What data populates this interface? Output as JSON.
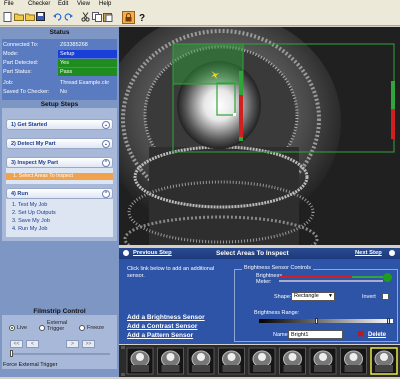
{
  "menu": [
    "File",
    "Checker",
    "Edit",
    "View",
    "Help"
  ],
  "status": {
    "title": "Status",
    "rows": [
      {
        "label": "Connected To:",
        "value": "Z63385268",
        "color": "#5a7bbf"
      },
      {
        "label": "Mode:",
        "value": "Setup",
        "color": "#1a3fd8"
      },
      {
        "label": "Part Detected:",
        "value": "Yes",
        "color": "#1e8c1e"
      },
      {
        "label": "Part Status:",
        "value": "Pass",
        "color": "#1e8c1e"
      },
      {
        "label": "Job:",
        "value": "Thread Example.ckr",
        "color": "#5a7bbf"
      },
      {
        "label": "Saved To Checker:",
        "value": "No",
        "color": "#5a7bbf"
      }
    ]
  },
  "setup": {
    "title": "Setup Steps",
    "steps": [
      "1) Get Started",
      "2) Detect My Part",
      "3) Inspect My Part",
      "4) Run"
    ],
    "active_substep": "1. Select Areas To Inspect",
    "run_links": [
      "1. Test My Job",
      "2. Set Up Outputs",
      "3. Save My Job",
      "4. Run My Job"
    ]
  },
  "filmstrip": {
    "title": "Filmstrip Control",
    "modes": [
      "Live",
      "External Trigger",
      "Freeze"
    ],
    "selected_mode": "Live",
    "nav": [
      "<<",
      "<",
      ">",
      ">>"
    ],
    "force_trigger": "Force External Trigger"
  },
  "step_nav": {
    "prev": "Previous Step",
    "title": "Select Areas To Inspect",
    "next": "Next Step"
  },
  "sensor_panel": {
    "hint": "Click link below to add an additional sensor.",
    "add_links": [
      "Add a Brightness Sensor",
      "Add a Contrast Sensor",
      "Add a Pattern Sensor"
    ],
    "controls_title": "Brightness Sensor Controls",
    "meter_label": "Brightness Meter:",
    "shape_label": "Shape:",
    "shape_value": "Rectangle",
    "invert_label": "Invert",
    "range_label": "Brightness Range:",
    "name_label": "Name:",
    "name_value": "Bright1",
    "delete_label": "Delete"
  },
  "colors": {
    "status_ok": "#1e8c1e",
    "active_step": "#f0a24c",
    "roi": "#2fa53a"
  }
}
